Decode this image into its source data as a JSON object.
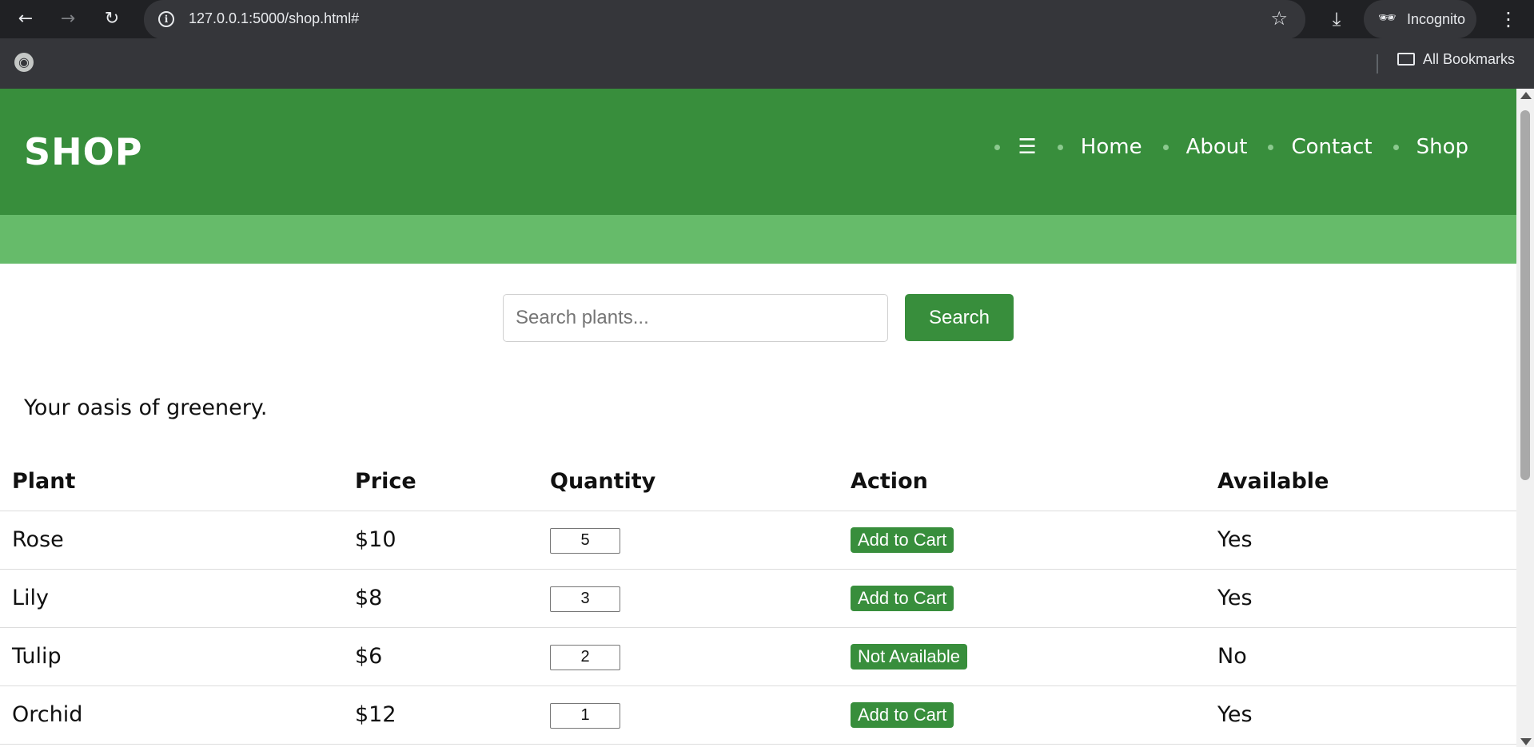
{
  "browser": {
    "url": "127.0.0.1:5000/shop.html#",
    "incognito_label": "Incognito",
    "bookmarks_label": "All Bookmarks",
    "icons": [
      "back-arrow-icon",
      "forward-arrow-icon",
      "reload-icon",
      "info-icon",
      "star-icon",
      "download-icon",
      "incognito-icon",
      "kebab-menu-icon",
      "globe-icon",
      "folder-icon"
    ]
  },
  "header": {
    "logo": "SHOP",
    "nav": [
      {
        "label": "☰"
      },
      {
        "label": "Home"
      },
      {
        "label": "About"
      },
      {
        "label": "Contact"
      },
      {
        "label": "Shop"
      }
    ]
  },
  "search": {
    "placeholder": "Search plants...",
    "value": "",
    "button_label": "Search"
  },
  "tagline": "Your oasis of greenery.",
  "table": {
    "headers": [
      "Plant",
      "Price",
      "Quantity",
      "Action",
      "Available"
    ],
    "rows": [
      {
        "plant": "Rose",
        "price": "$10",
        "quantity": "5",
        "action": "Add to Cart",
        "available": "Yes"
      },
      {
        "plant": "Lily",
        "price": "$8",
        "quantity": "3",
        "action": "Add to Cart",
        "available": "Yes"
      },
      {
        "plant": "Tulip",
        "price": "$6",
        "quantity": "2",
        "action": "Not Available",
        "available": "No"
      },
      {
        "plant": "Orchid",
        "price": "$12",
        "quantity": "1",
        "action": "Add to Cart",
        "available": "Yes"
      }
    ]
  },
  "colors": {
    "header_bg": "#388e3c",
    "subbar_bg": "#66bb6a",
    "button_bg": "#388e3c"
  }
}
